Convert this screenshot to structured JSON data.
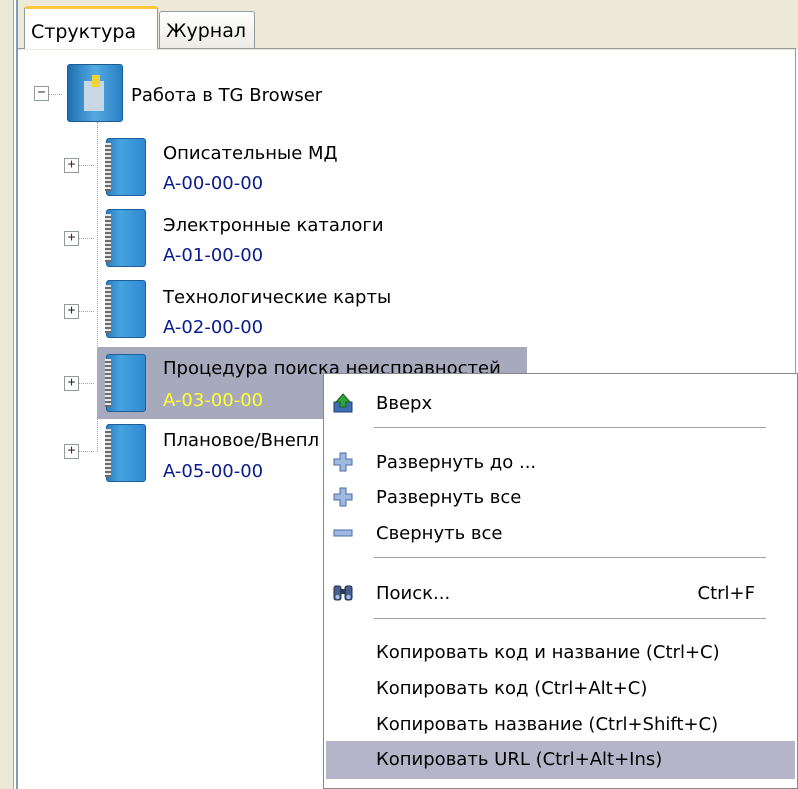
{
  "tabs": [
    {
      "label": "Структура",
      "active": true
    },
    {
      "label": "Журнал",
      "active": false
    }
  ],
  "tree": {
    "root": {
      "label": "Работа в TG Browser",
      "expander": "−"
    },
    "nodes": [
      {
        "title": "Описательные МД",
        "code": "A-00-00-00",
        "expander": "+"
      },
      {
        "title": "Электронные каталоги",
        "code": "A-01-00-00",
        "expander": "+"
      },
      {
        "title": "Технологические карты",
        "code": "A-02-00-00",
        "expander": "+"
      },
      {
        "title": "Процедура поиска неисправностей",
        "code": "A-03-00-00",
        "expander": "+",
        "selected": true
      },
      {
        "title": "Плановое/Внепл",
        "code": "A-05-00-00",
        "expander": "+"
      }
    ]
  },
  "context_menu": {
    "items": [
      {
        "label": "Вверх",
        "icon": "up-arrow-icon"
      },
      {
        "label": "Развернуть до ...",
        "icon": "expand-to-icon"
      },
      {
        "label": "Развернуть все",
        "icon": "expand-all-icon"
      },
      {
        "label": "Свернуть все",
        "icon": "collapse-all-icon"
      },
      {
        "label": "Поиск...",
        "icon": "binoculars-icon",
        "shortcut": "Ctrl+F"
      },
      {
        "label": "Копировать код и название (Ctrl+C)"
      },
      {
        "label": "Копировать код (Ctrl+Alt+C)"
      },
      {
        "label": "Копировать название (Ctrl+Shift+C)"
      },
      {
        "label": "Копировать URL (Ctrl+Alt+Ins)",
        "highlighted": true
      }
    ]
  },
  "colors": {
    "selection": "#a7a9bd",
    "selected_code": "#ffff33",
    "code": "#0a1c8c",
    "menu_hover": "#b6b4c9",
    "tab_accent": "#ffc83c"
  }
}
